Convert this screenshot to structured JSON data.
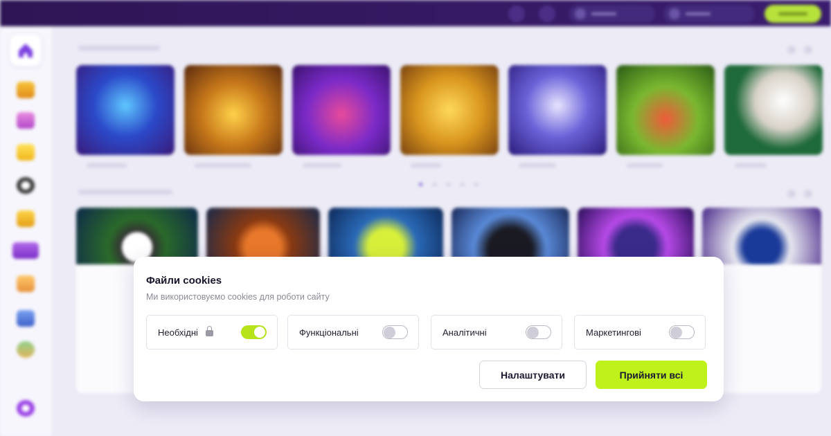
{
  "cookie_modal": {
    "title": "Файли cookies",
    "subtitle": "Ми використовуємо cookies для роботи сайту",
    "options": [
      {
        "label": "Необхідні",
        "enabled": true,
        "locked": true
      },
      {
        "label": "Функціональні",
        "enabled": false,
        "locked": false
      },
      {
        "label": "Аналітичні",
        "enabled": false,
        "locked": false
      },
      {
        "label": "Маркетингові",
        "enabled": false,
        "locked": false
      }
    ],
    "settings_label": "Налаштувати",
    "accept_label": "Прийняти всі"
  },
  "colors": {
    "accent_green": "#bff21b",
    "toggle_on": "#b6e31c",
    "topbar": "#2e1555"
  },
  "background_icons": [
    "home-icon",
    "crown-icon",
    "gift-icon",
    "cube-icon",
    "soccer-ball-icon",
    "trophy-icon",
    "slots-777-icon",
    "cat-icon",
    "ticket-icon",
    "globe-icon",
    "headset-icon"
  ]
}
